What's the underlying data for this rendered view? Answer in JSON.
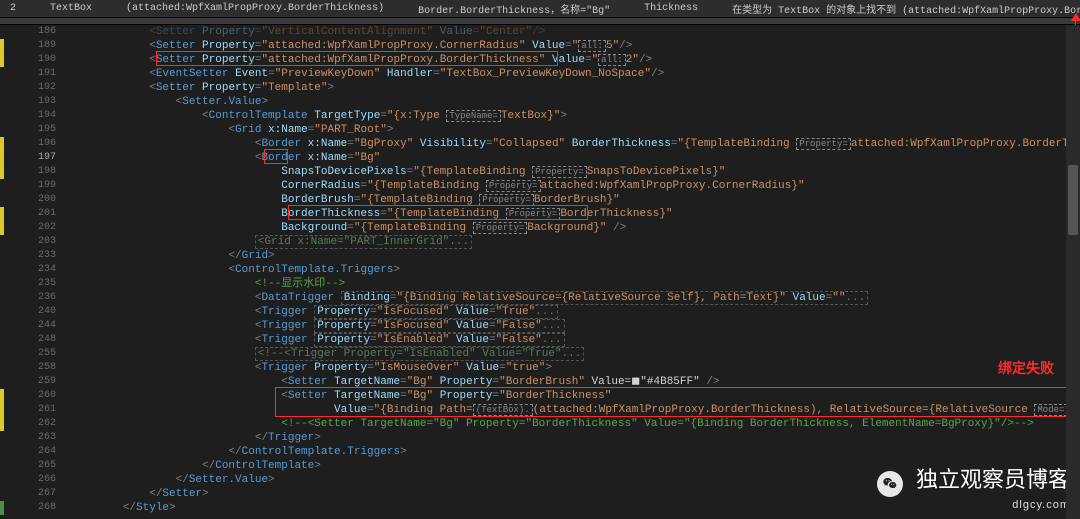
{
  "error_bar": {
    "count": "2",
    "col1": "TextBox",
    "col2": "(attached:WpfXamlPropProxy.BorderThickness)",
    "col3": "Border.BorderThickness，名称=\"Bg\"",
    "col4": "Thickness",
    "col5": "在类型为 TextBox 的对象上找不到 (attached:WpfXamlPropProxy.BorderThickness) 属性。"
  },
  "lines": [
    {
      "n": "186",
      "cls": "",
      "ind": 3,
      "raw": "<Setter Property=\"VerticalContentAlignment\" Value=\"Center\"/>",
      "dim": true
    },
    {
      "n": "189",
      "cls": "y",
      "ind": 3,
      "raw": "<Setter Property=\"attached:WpfXamlPropProxy.CornerRadius\" Value=\"{all:}5\"/>"
    },
    {
      "n": "190",
      "cls": "y",
      "ind": 3,
      "raw": "<Setter Property=\"attached:WpfXamlPropProxy.BorderThickness\" Value=\"{all:}2\"/>"
    },
    {
      "n": "191",
      "cls": "",
      "ind": 3,
      "raw": "<EventSetter Event=\"PreviewKeyDown\" Handler=\"TextBox_PreviewKeyDown_NoSpace\"/>"
    },
    {
      "n": "192",
      "cls": "",
      "ind": 3,
      "raw": "<Setter Property=\"Template\">",
      "fold": "-"
    },
    {
      "n": "193",
      "cls": "",
      "ind": 4,
      "raw": "<Setter.Value>"
    },
    {
      "n": "194",
      "cls": "",
      "ind": 5,
      "raw": "<ControlTemplate TargetType=\"{x:Type TypeName=TextBox}\">",
      "fold": "-"
    },
    {
      "n": "195",
      "cls": "",
      "ind": 6,
      "raw": "<Grid x:Name=\"PART_Root\">",
      "fold": "-"
    },
    {
      "n": "196",
      "cls": "y",
      "ind": 7,
      "raw": "<Border x:Name=\"BgProxy\" Visibility=\"Collapsed\" BorderThickness=\"{TemplateBinding Property=attached:WpfXamlPropProxy.BorderThickness}\"/>"
    },
    {
      "n": "197",
      "cls": "y",
      "ind": 7,
      "raw": "<Border x:Name=\"Bg\"",
      "fold": "-"
    },
    {
      "n": "198",
      "cls": "y",
      "ind": 8,
      "raw": "SnapsToDevicePixels=\"{TemplateBinding Property=SnapsToDevicePixels}\""
    },
    {
      "n": "199",
      "cls": "",
      "ind": 8,
      "raw": "CornerRadius=\"{TemplateBinding Property=attached:WpfXamlPropProxy.CornerRadius}\""
    },
    {
      "n": "200",
      "cls": "",
      "ind": 8,
      "raw": "BorderBrush=\"{TemplateBinding Property=BorderBrush}\""
    },
    {
      "n": "201",
      "cls": "y",
      "ind": 8,
      "raw": "BorderThickness=\"{TemplateBinding Property=BorderThickness}\""
    },
    {
      "n": "202",
      "cls": "y",
      "ind": 8,
      "raw": "Background=\"{TemplateBinding Property=Background}\" />"
    },
    {
      "n": "203",
      "cls": "",
      "ind": 7,
      "raw": "<Grid x:Name=\"PART_InnerGrid\"...",
      "fold": "+",
      "dimall": true
    },
    {
      "n": "233",
      "cls": "",
      "ind": 6,
      "raw": "</Grid>"
    },
    {
      "n": "234",
      "cls": "",
      "ind": 6,
      "raw": "<ControlTemplate.Triggers>",
      "fold": "-"
    },
    {
      "n": "235",
      "cls": "",
      "ind": 7,
      "cmt": "<!--显示水印-->"
    },
    {
      "n": "236",
      "cls": "",
      "ind": 7,
      "raw": "<DataTrigger Binding=\"{Binding RelativeSource={RelativeSource Self}, Path=Text}\" Value=\"\"...",
      "fold": "+",
      "dimtail": true
    },
    {
      "n": "240",
      "cls": "",
      "ind": 7,
      "raw": "<Trigger Property=\"IsFocused\" Value=\"True\"...",
      "fold": "+",
      "dimtail": true
    },
    {
      "n": "244",
      "cls": "",
      "ind": 7,
      "raw": "<Trigger Property=\"IsFocused\" Value=\"False\"...",
      "fold": "+",
      "dimtail": true
    },
    {
      "n": "248",
      "cls": "",
      "ind": 7,
      "raw": "<Trigger Property=\"IsEnabled\" Value=\"False\"...",
      "fold": "+",
      "dimtail": true
    },
    {
      "n": "255",
      "cls": "",
      "ind": 7,
      "cmt": "<!--<Trigger Property=\"IsEnabled\" Value=\"True\"...",
      "fold": "+",
      "dimall": true
    },
    {
      "n": "258",
      "cls": "",
      "ind": 7,
      "raw": "<Trigger Property=\"IsMouseOver\" Value=\"true\">",
      "fold": "-"
    },
    {
      "n": "259",
      "cls": "",
      "ind": 8,
      "raw": "<Setter TargetName=\"Bg\" Property=\"BorderBrush\" Value=◼\"#4B85FF\" />"
    },
    {
      "n": "260",
      "cls": "y",
      "ind": 8,
      "raw": "<Setter TargetName=\"Bg\" Property=\"BorderThickness\""
    },
    {
      "n": "261",
      "cls": "y",
      "ind": 10,
      "raw": "Value=\"{Binding Path=(TextBox).(attached:WpfXamlPropProxy.BorderThickness), RelativeSource={RelativeSource Mode=TemplatedParent}}\"/>"
    },
    {
      "n": "262",
      "cls": "y",
      "ind": 8,
      "cmt": "<!--<Setter TargetName=\"Bg\" Property=\"BorderThickness\" Value=\"{Binding BorderThickness, ElementName=BgProxy}\"/>-->"
    },
    {
      "n": "263",
      "cls": "",
      "ind": 7,
      "raw": "</Trigger>"
    },
    {
      "n": "264",
      "cls": "",
      "ind": 6,
      "raw": "</ControlTemplate.Triggers>"
    },
    {
      "n": "265",
      "cls": "",
      "ind": 5,
      "raw": "</ControlTemplate>"
    },
    {
      "n": "266",
      "cls": "",
      "ind": 4,
      "raw": "</Setter.Value>"
    },
    {
      "n": "267",
      "cls": "",
      "ind": 3,
      "raw": "</Setter>"
    },
    {
      "n": "268",
      "cls": "g",
      "ind": 2,
      "raw": "</Style>"
    }
  ],
  "red_label": "绑定失败",
  "watermark": {
    "title": "独立观察员博客",
    "sub": "dlgcy.com"
  }
}
